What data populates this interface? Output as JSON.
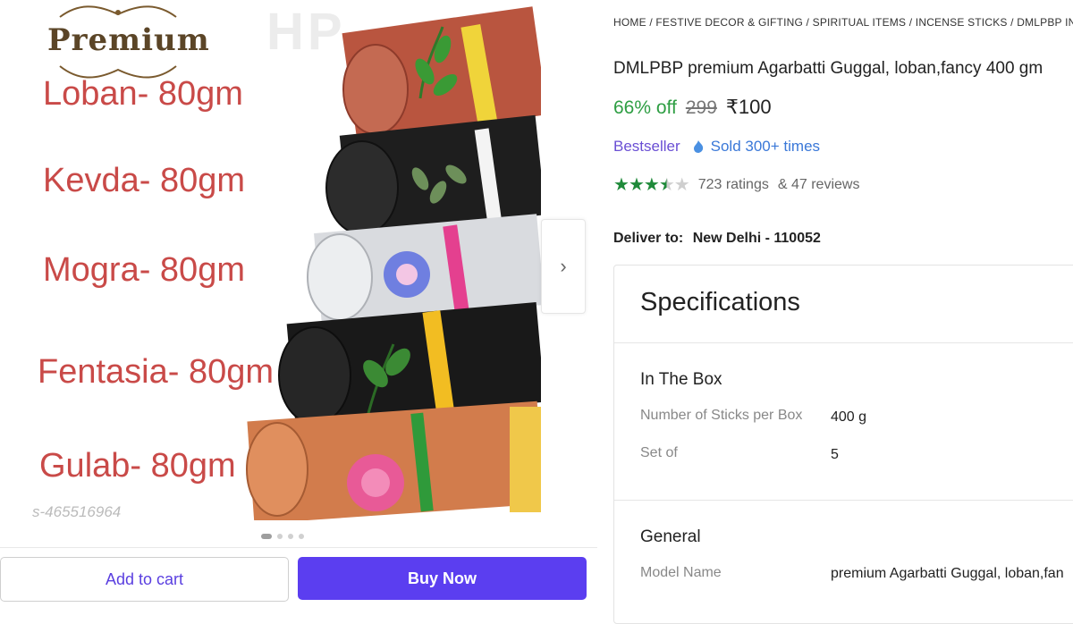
{
  "gallery": {
    "brand_badge": "Premium",
    "watermark": "HP",
    "labels": [
      "Loban- 80gm",
      "Kevda- 80gm",
      "Mogra- 80gm",
      "Fentasia- 80gm",
      "Gulab- 80gm"
    ],
    "sku": "s-465516964",
    "next_icon": "chevron-right-icon",
    "dots_total": 4,
    "dots_active": 1
  },
  "actions": {
    "add_to_cart": "Add to cart",
    "buy_now": "Buy Now",
    "buy_color": "#5b3ef0"
  },
  "breadcrumb": "HOME / FESTIVE DECOR & GIFTING / SPIRITUAL ITEMS / INCENSE STICKS / DMLPBP INCE",
  "product": {
    "title": "DMLPBP premium Agarbatti Guggal, loban,fancy 400 gm",
    "discount": "66% off",
    "mrp": "299",
    "price": "₹100",
    "bestseller": "Bestseller",
    "sold": "Sold 300+ times",
    "rating_stars": 3.5,
    "ratings_text": "723 ratings",
    "reviews_text": "& 47 reviews",
    "deliver_label": "Deliver to:",
    "deliver_value": "New Delhi - 110052"
  },
  "specifications": {
    "title": "Specifications",
    "in_the_box": {
      "title": "In The Box",
      "rows": [
        {
          "label": "Number of Sticks per Box",
          "value": "400 g"
        },
        {
          "label": "Set of",
          "value": "5"
        }
      ]
    },
    "general": {
      "title": "General",
      "rows": [
        {
          "label": "Model Name",
          "value": "premium Agarbatti Guggal, loban,fan"
        }
      ]
    }
  },
  "colors": {
    "discount_green": "#2e9e43",
    "label_red": "#c94a48",
    "accent_purple": "#5b3ef0"
  }
}
